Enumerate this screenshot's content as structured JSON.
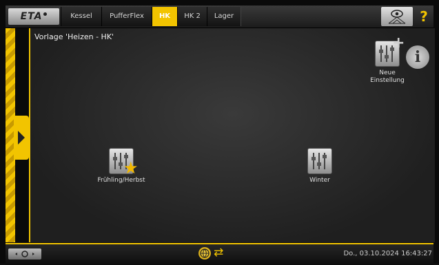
{
  "header": {
    "logo_text": "ETA",
    "tabs": [
      {
        "label": "Kessel",
        "active": false
      },
      {
        "label": "PufferFlex",
        "active": false
      },
      {
        "label": "HK",
        "active": true
      },
      {
        "label": "HK 2",
        "active": false
      },
      {
        "label": "Lager",
        "active": false
      }
    ],
    "help_label": "?"
  },
  "main": {
    "title": "Vorlage 'Heizen - HK'",
    "new_setting": {
      "line1": "Neue",
      "line2": "Einstellung"
    },
    "info_label": "i",
    "presets": [
      {
        "label": "Frühling/Herbst",
        "favorite": true
      },
      {
        "label": "Winter",
        "favorite": false
      }
    ]
  },
  "footer": {
    "datetime": "Do., 03.10.2024 16:43:27"
  },
  "colors": {
    "accent": "#f2c400",
    "background": "#2a2a2a"
  },
  "icons": [
    "menu-arrow-icon",
    "eye-network-icon",
    "help-icon",
    "sliders-icon",
    "plus-icon",
    "star-icon",
    "info-icon",
    "tools-icon",
    "globe-icon",
    "sync-icon"
  ]
}
